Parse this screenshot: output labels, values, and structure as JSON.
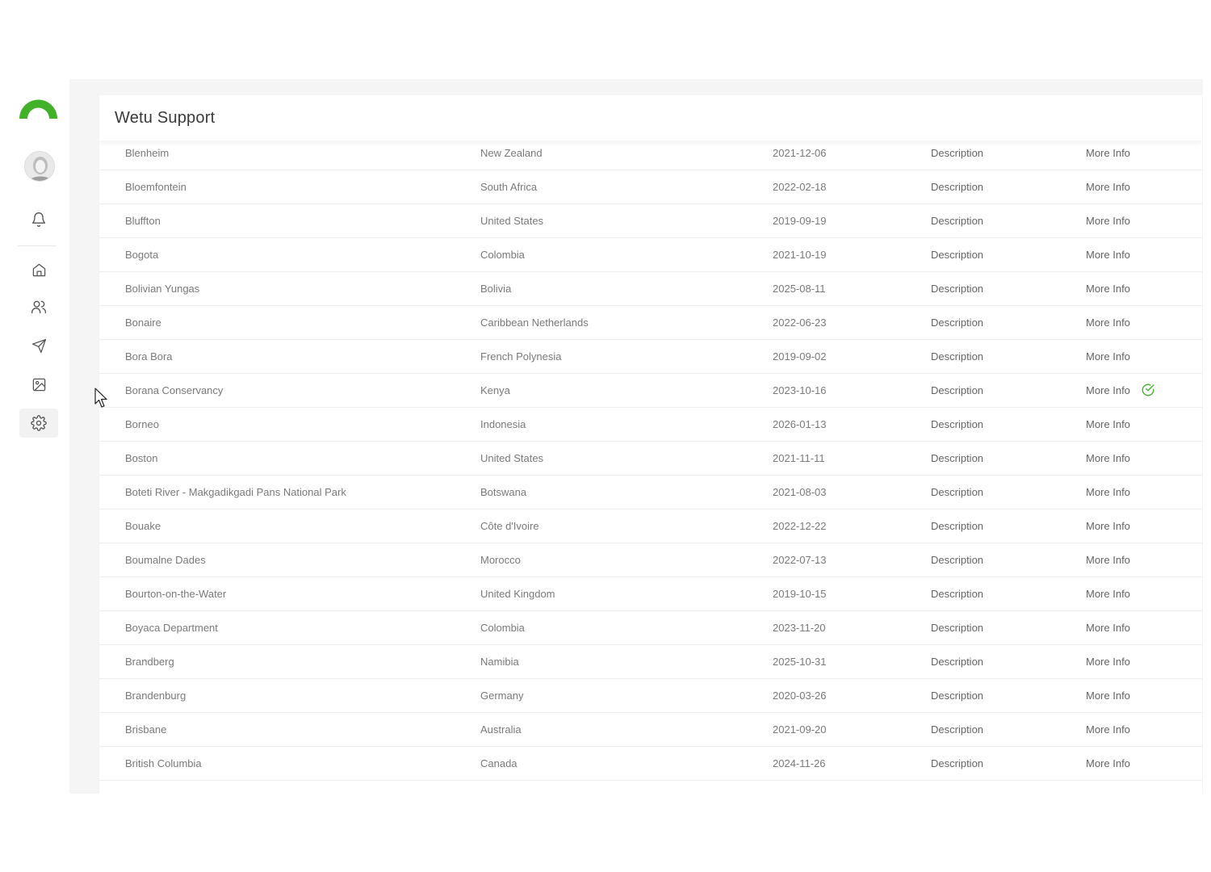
{
  "app": {
    "title": "Wetu Support",
    "accent_color": "#43b02a"
  },
  "sidebar": {
    "logo": "wetu-logo",
    "avatar": "user-avatar",
    "items": [
      {
        "icon": "bell-icon",
        "label": "Notifications"
      },
      {
        "icon": "home-icon",
        "label": "Home"
      },
      {
        "icon": "users-icon",
        "label": "Users"
      },
      {
        "icon": "send-icon",
        "label": "Send"
      },
      {
        "icon": "image-icon",
        "label": "Images"
      },
      {
        "icon": "gear-icon",
        "label": "Settings",
        "active": true
      }
    ]
  },
  "table": {
    "rows": [
      {
        "name": "Blenheim",
        "country": "New Zealand",
        "date": "2021-12-06",
        "description": "Description",
        "more": "More Info"
      },
      {
        "name": "Bloemfontein",
        "country": "South Africa",
        "date": "2022-02-18",
        "description": "Description",
        "more": "More Info"
      },
      {
        "name": "Bluffton",
        "country": "United States",
        "date": "2019-09-19",
        "description": "Description",
        "more": "More Info"
      },
      {
        "name": "Bogota",
        "country": "Colombia",
        "date": "2021-10-19",
        "description": "Description",
        "more": "More Info"
      },
      {
        "name": "Bolivian Yungas",
        "country": "Bolivia",
        "date": "2025-08-11",
        "description": "Description",
        "more": "More Info"
      },
      {
        "name": "Bonaire",
        "country": "Caribbean Netherlands",
        "date": "2022-06-23",
        "description": "Description",
        "more": "More Info"
      },
      {
        "name": "Bora Bora",
        "country": "French Polynesia",
        "date": "2019-09-02",
        "description": "Description",
        "more": "More Info"
      },
      {
        "name": "Borana Conservancy",
        "country": "Kenya",
        "date": "2023-10-16",
        "description": "Description",
        "more": "More Info",
        "checked": true
      },
      {
        "name": "Borneo",
        "country": "Indonesia",
        "date": "2026-01-13",
        "description": "Description",
        "more": "More Info"
      },
      {
        "name": "Boston",
        "country": "United States",
        "date": "2021-11-11",
        "description": "Description",
        "more": "More Info"
      },
      {
        "name": "Boteti River - Makgadikgadi Pans National Park",
        "country": "Botswana",
        "date": "2021-08-03",
        "description": "Description",
        "more": "More Info"
      },
      {
        "name": "Bouake",
        "country": "Côte d'Ivoire",
        "date": "2022-12-22",
        "description": "Description",
        "more": "More Info"
      },
      {
        "name": "Boumalne Dades",
        "country": "Morocco",
        "date": "2022-07-13",
        "description": "Description",
        "more": "More Info"
      },
      {
        "name": "Bourton-on-the-Water",
        "country": "United Kingdom",
        "date": "2019-10-15",
        "description": "Description",
        "more": "More Info"
      },
      {
        "name": "Boyaca Department",
        "country": "Colombia",
        "date": "2023-11-20",
        "description": "Description",
        "more": "More Info"
      },
      {
        "name": "Brandberg",
        "country": "Namibia",
        "date": "2025-10-31",
        "description": "Description",
        "more": "More Info"
      },
      {
        "name": "Brandenburg",
        "country": "Germany",
        "date": "2020-03-26",
        "description": "Description",
        "more": "More Info"
      },
      {
        "name": "Brisbane",
        "country": "Australia",
        "date": "2021-09-20",
        "description": "Description",
        "more": "More Info"
      },
      {
        "name": "British Columbia",
        "country": "Canada",
        "date": "2024-11-26",
        "description": "Description",
        "more": "More Info"
      }
    ]
  }
}
